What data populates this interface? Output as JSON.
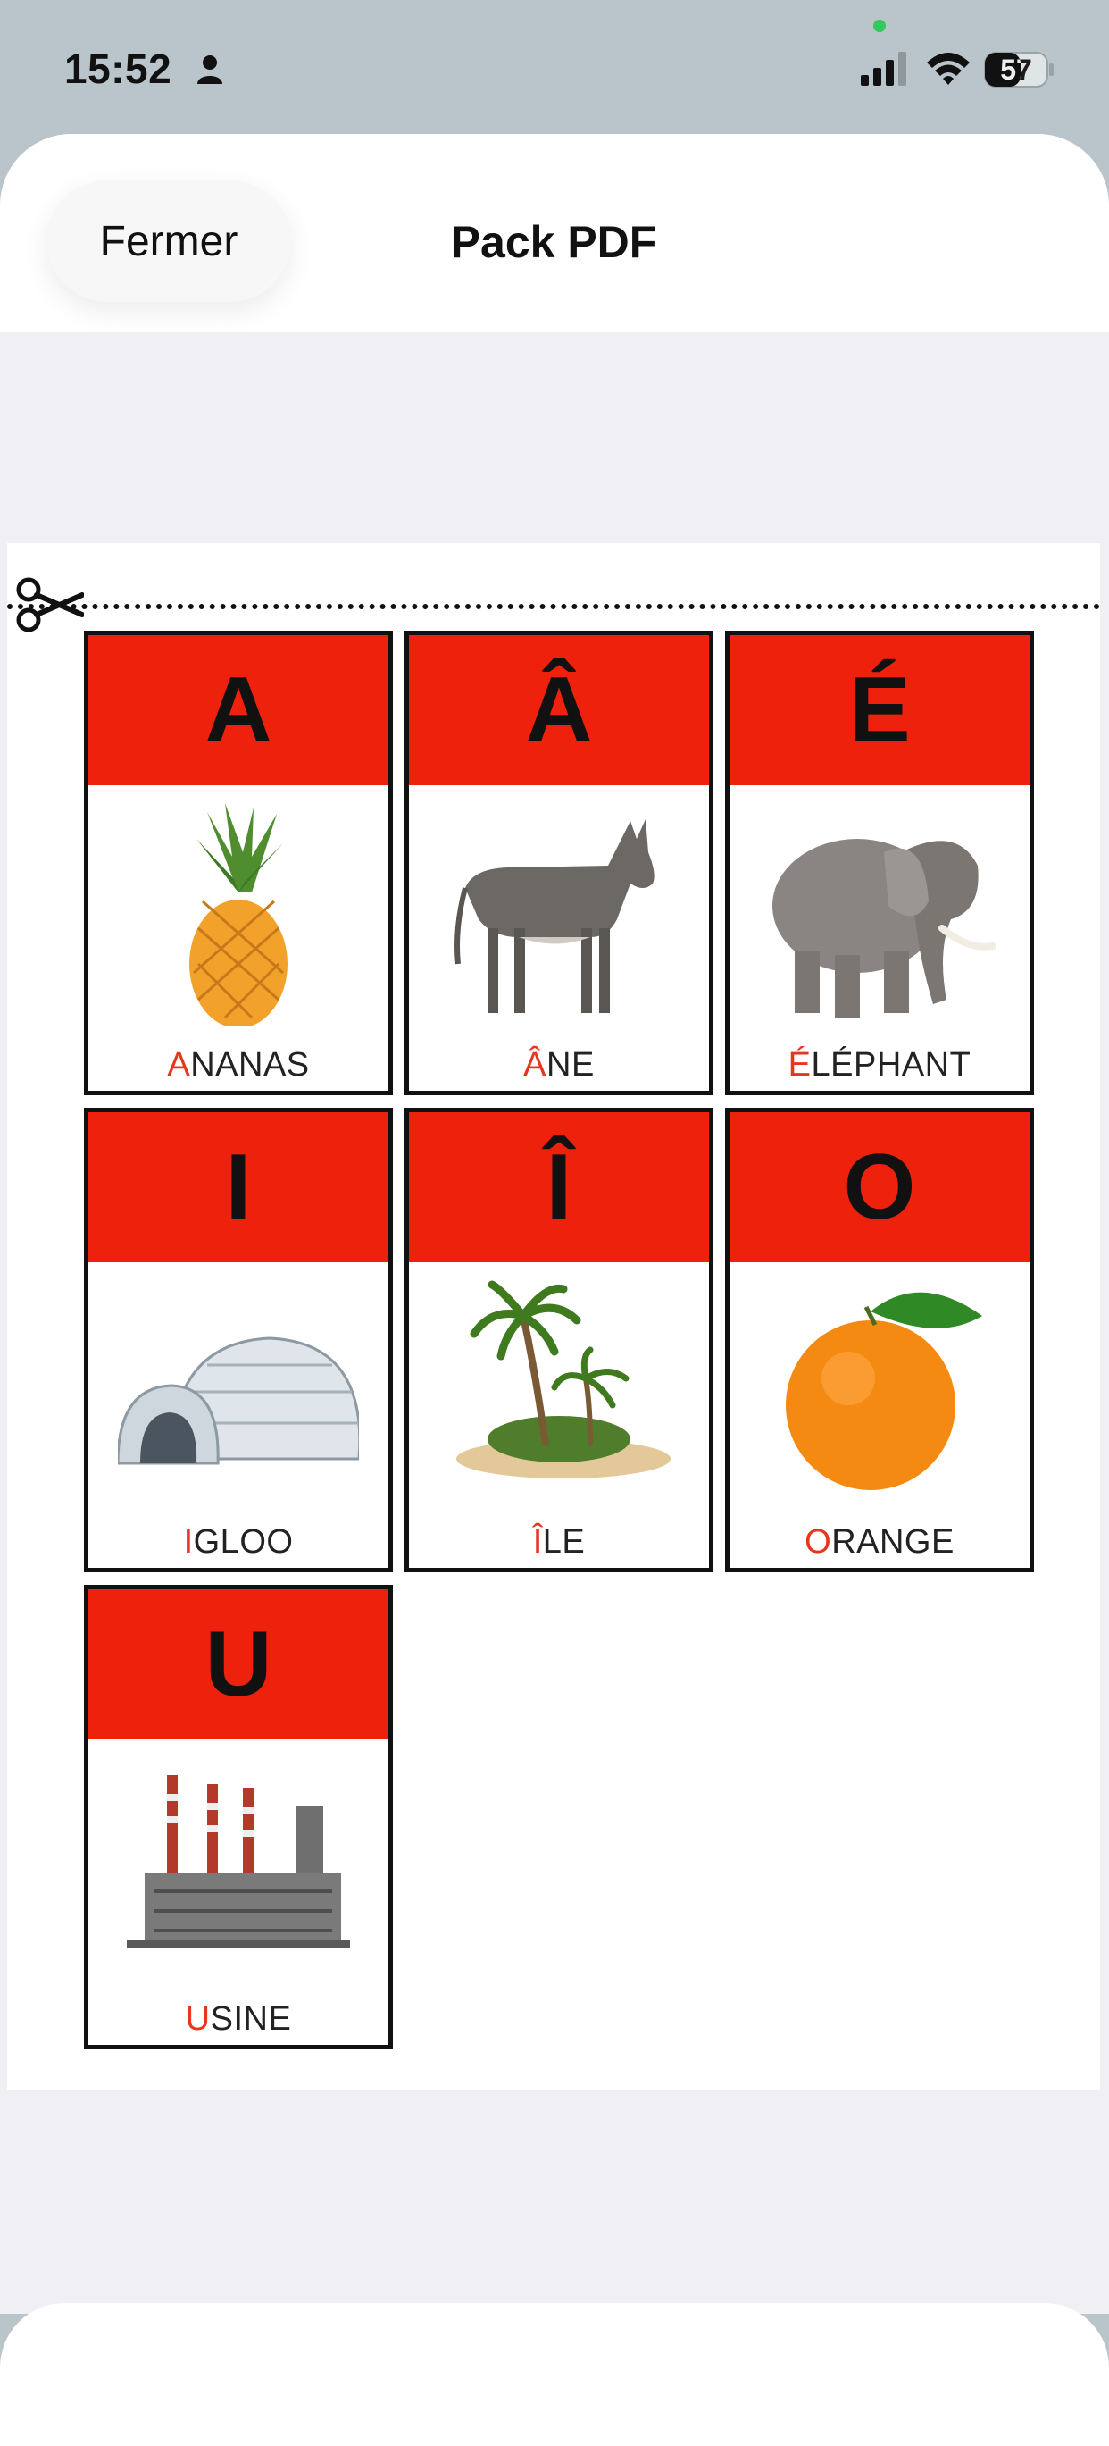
{
  "status_bar": {
    "time": "15:52",
    "battery_level": "57",
    "icons": [
      "person-icon",
      "signal-icon",
      "wifi-icon",
      "battery-icon"
    ]
  },
  "sheet": {
    "close_label": "Fermer",
    "title": "Pack PDF"
  },
  "document": {
    "icons": [
      "scissors-icon"
    ],
    "cards": [
      {
        "letter": "A",
        "word_first": "A",
        "word_rest": "NANAS",
        "picture": "pineapple"
      },
      {
        "letter": "Â",
        "word_first": "Â",
        "word_rest": "NE",
        "picture": "donkey"
      },
      {
        "letter": "É",
        "word_first": "É",
        "word_rest": "LÉPHANT",
        "picture": "elephant"
      },
      {
        "letter": "I",
        "word_first": "I",
        "word_rest": "GLOO",
        "picture": "igloo"
      },
      {
        "letter": "Î",
        "word_first": "Î",
        "word_rest": "LE",
        "picture": "island"
      },
      {
        "letter": "O",
        "word_first": "O",
        "word_rest": "RANGE",
        "picture": "orange"
      },
      {
        "letter": "U",
        "word_first": "U",
        "word_rest": "SINE",
        "picture": "factory"
      }
    ]
  },
  "colors": {
    "card_header": "#ee210d",
    "first_letter": "#e8351f",
    "status_bg": "#b9c5ca",
    "sheet_bg": "#f0f0f4"
  }
}
